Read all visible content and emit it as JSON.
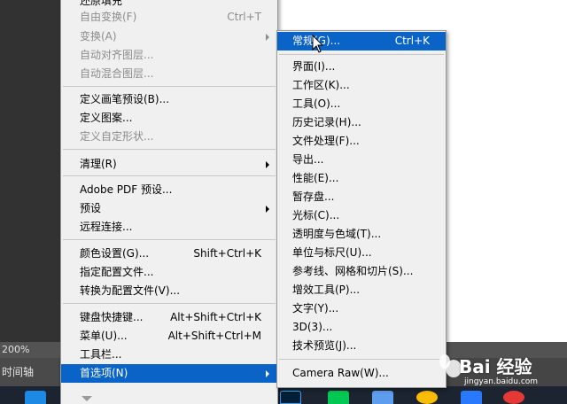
{
  "status": {
    "zoom": "200%",
    "panel_tab": "时间轴"
  },
  "edit_menu": {
    "items": [
      {
        "label": "还原填充",
        "shortcut": "",
        "disabled": false
      },
      {
        "label": "自由变换(F)",
        "shortcut": "Ctrl+T",
        "disabled": true
      },
      {
        "label": "变换(A)",
        "shortcut": "",
        "disabled": true
      },
      {
        "label": "自动对齐图层...",
        "shortcut": "",
        "disabled": true
      },
      {
        "label": "自动混合图层...",
        "shortcut": "",
        "disabled": true
      },
      {
        "label": "定义画笔预设(B)...",
        "shortcut": "",
        "disabled": false
      },
      {
        "label": "定义图案...",
        "shortcut": "",
        "disabled": false
      },
      {
        "label": "定义自定形状...",
        "shortcut": "",
        "disabled": true
      },
      {
        "label": "清理(R)",
        "shortcut": "",
        "disabled": false
      },
      {
        "label": "Adobe PDF 预设...",
        "shortcut": "",
        "disabled": false
      },
      {
        "label": "预设",
        "shortcut": "",
        "disabled": false
      },
      {
        "label": "远程连接...",
        "shortcut": "",
        "disabled": false
      },
      {
        "label": "颜色设置(G)...",
        "shortcut": "Shift+Ctrl+K",
        "disabled": false
      },
      {
        "label": "指定配置文件...",
        "shortcut": "",
        "disabled": false
      },
      {
        "label": "转换为配置文件(V)...",
        "shortcut": "",
        "disabled": false
      },
      {
        "label": "键盘快捷键...",
        "shortcut": "Alt+Shift+Ctrl+K",
        "disabled": false
      },
      {
        "label": "菜单(U)...",
        "shortcut": "Alt+Shift+Ctrl+M",
        "disabled": false
      },
      {
        "label": "工具栏...",
        "shortcut": "",
        "disabled": false
      },
      {
        "label": "首选项(N)",
        "shortcut": "",
        "disabled": false
      }
    ]
  },
  "prefs_submenu": {
    "items": [
      {
        "label": "常规(G)...",
        "shortcut": "Ctrl+K"
      },
      {
        "label": "界面(I)...",
        "shortcut": ""
      },
      {
        "label": "工作区(K)...",
        "shortcut": ""
      },
      {
        "label": "工具(O)...",
        "shortcut": ""
      },
      {
        "label": "历史记录(H)...",
        "shortcut": ""
      },
      {
        "label": "文件处理(F)...",
        "shortcut": ""
      },
      {
        "label": "导出...",
        "shortcut": ""
      },
      {
        "label": "性能(E)...",
        "shortcut": ""
      },
      {
        "label": "暂存盘...",
        "shortcut": ""
      },
      {
        "label": "光标(C)...",
        "shortcut": ""
      },
      {
        "label": "透明度与色域(T)...",
        "shortcut": ""
      },
      {
        "label": "单位与标尺(U)...",
        "shortcut": ""
      },
      {
        "label": "参考线、网格和切片(S)...",
        "shortcut": ""
      },
      {
        "label": "增效工具(P)...",
        "shortcut": ""
      },
      {
        "label": "文字(Y)...",
        "shortcut": ""
      },
      {
        "label": "3D(3)...",
        "shortcut": ""
      },
      {
        "label": "技术预览(J)...",
        "shortcut": ""
      },
      {
        "label": "Camera Raw(W)...",
        "shortcut": ""
      }
    ]
  },
  "watermark": {
    "text": "Bai 经验",
    "url": "jingyan.baidu.com"
  },
  "colors": {
    "highlight": "#0a64c8",
    "menu_bg": "#f0f0f0",
    "disabled_text": "#8c8c8c"
  }
}
